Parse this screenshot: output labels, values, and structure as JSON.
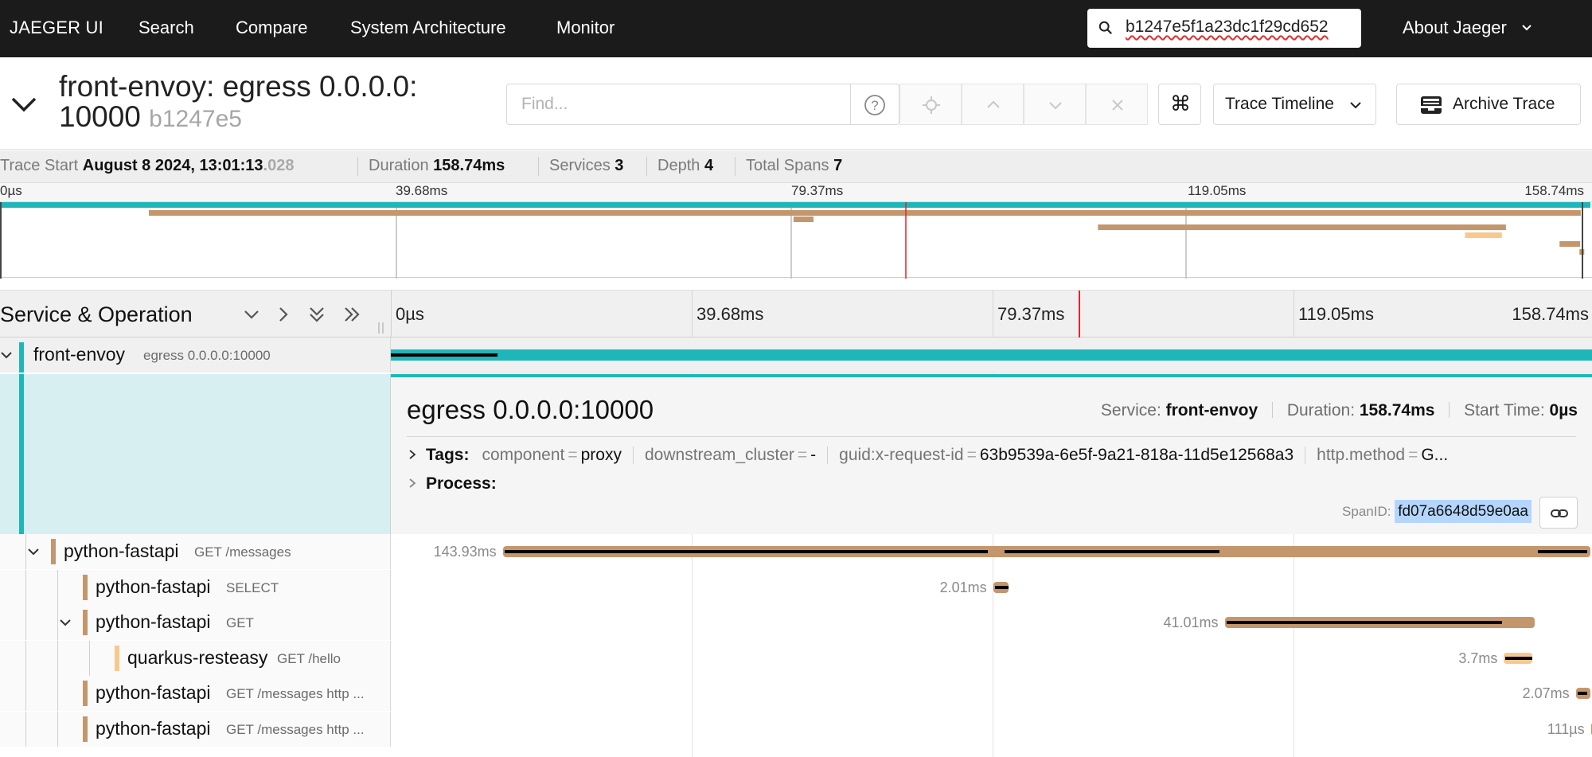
{
  "nav": {
    "brand": "JAEGER UI",
    "links": [
      "Search",
      "Compare",
      "System Architecture",
      "Monitor"
    ],
    "search_value": "b1247e5f1a23dc1f29cd652",
    "about": "About Jaeger"
  },
  "trace": {
    "title": "front-envoy: egress 0.0.0.0:",
    "title_line2": "10000",
    "short_id": "b1247e5",
    "find_placeholder": "Find...",
    "view_mode": "Trace Timeline",
    "archive_label": "Archive Trace",
    "kbd_glyph": "⌘"
  },
  "summary": {
    "trace_start_label": "Trace Start",
    "trace_start_value": "August 8 2024, 13:01:13",
    "trace_start_ms": ".028",
    "duration_label": "Duration",
    "duration_value": "158.74ms",
    "services_label": "Services",
    "services_value": "3",
    "depth_label": "Depth",
    "depth_value": "4",
    "total_spans_label": "Total Spans",
    "total_spans_value": "7"
  },
  "ticks": [
    "0µs",
    "39.68ms",
    "79.37ms",
    "119.05ms",
    "158.74ms"
  ],
  "timeline_header": {
    "title": "Service & Operation"
  },
  "colors": {
    "front_envoy": "#1fb6b9",
    "python_fastapi": "#c4966c",
    "quarkus_resteasy": "#f9c88f"
  },
  "spans": [
    {
      "service": "front-envoy",
      "operation": "egress 0.0.0.0:10000",
      "duration": "158.74ms",
      "start_ms": 0,
      "dur_ms": 158.74,
      "depth": 0,
      "expanded": true
    },
    {
      "service": "python-fastapi",
      "operation": "GET /messages",
      "duration": "143.93ms",
      "start_ms": 14.8,
      "dur_ms": 143.93,
      "depth": 1,
      "expanded": true
    },
    {
      "service": "python-fastapi",
      "operation": "SELECT",
      "duration": "2.01ms",
      "start_ms": 79.6,
      "dur_ms": 2.01,
      "depth": 2,
      "expanded": null
    },
    {
      "service": "python-fastapi",
      "operation": "GET",
      "duration": "41.01ms",
      "start_ms": 110.2,
      "dur_ms": 41.01,
      "depth": 2,
      "expanded": true
    },
    {
      "service": "quarkus-resteasy",
      "operation": "GET /hello",
      "duration": "3.7ms",
      "start_ms": 147.1,
      "dur_ms": 3.7,
      "depth": 3,
      "expanded": null
    },
    {
      "service": "python-fastapi",
      "operation": "GET /messages http ...",
      "duration": "2.07ms",
      "start_ms": 156.6,
      "dur_ms": 2.07,
      "depth": 2,
      "expanded": null
    },
    {
      "service": "python-fastapi",
      "operation": "GET /messages http ...",
      "duration": "111µs",
      "start_ms": 158.6,
      "dur_ms": 0.111,
      "depth": 2,
      "expanded": null
    }
  ],
  "detail": {
    "operation": "egress 0.0.0.0:10000",
    "service_label": "Service:",
    "service_value": "front-envoy",
    "duration_label": "Duration:",
    "duration_value": "158.74ms",
    "start_label": "Start Time:",
    "start_value": "0µs",
    "tags_label": "Tags:",
    "tags": [
      {
        "key": "component",
        "value": "proxy"
      },
      {
        "key": "downstream_cluster",
        "value": "-"
      },
      {
        "key": "guid:x-request-id",
        "value": "63b9539a-6e5f-9a21-818a-11d5e12568a3"
      },
      {
        "key": "http.method",
        "value": "G..."
      }
    ],
    "process_label": "Process:",
    "spanid_label": "SpanID:",
    "spanid_value": "fd07a6648d59e0aa"
  }
}
